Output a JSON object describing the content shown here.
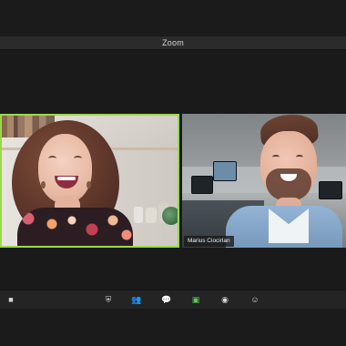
{
  "window": {
    "title": "Zoom"
  },
  "participants": [
    {
      "name": ""
    },
    {
      "name": "Marius Ciocirlan"
    }
  ],
  "toolbar": {
    "items": [
      {
        "icon": "video-camera-icon",
        "active": false
      },
      {
        "icon": "shield-icon",
        "active": false
      },
      {
        "icon": "participants-icon",
        "active": false
      },
      {
        "icon": "chat-bubble-icon",
        "active": false
      },
      {
        "icon": "share-screen-icon",
        "active": true
      },
      {
        "icon": "record-icon",
        "active": false
      },
      {
        "icon": "reactions-icon",
        "active": false
      }
    ]
  },
  "colors": {
    "active_speaker_border": "#9bd94a",
    "toolbar_bg": "#242424",
    "window_bg": "#1c1c1c",
    "titlebar_bg": "#2b2b2b",
    "active_icon": "#5cc95d"
  }
}
